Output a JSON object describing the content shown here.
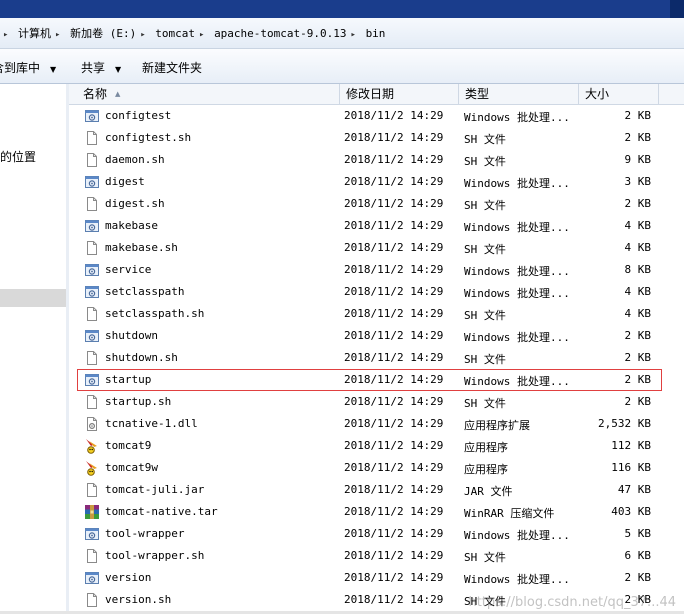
{
  "address_bar": {
    "crumbs": [
      "计算机",
      "新加卷 (E:)",
      "tomcat",
      "apache-tomcat-9.0.13",
      "bin"
    ],
    "lead_arrow": "▸",
    "separator": "▸"
  },
  "toolbar": {
    "library_label": "含到库中",
    "share_label": "共享",
    "new_folder_label": "新建文件夹",
    "dropdown_glyph": "▼"
  },
  "nav_pane": {
    "recent_places_label": "问的位置"
  },
  "columns": {
    "name": "名称",
    "date": "修改日期",
    "type": "类型",
    "size": "大小"
  },
  "files": [
    {
      "name": "configtest",
      "date": "2018/11/2 14:29",
      "type": "Windows 批处理...",
      "size": "2 KB",
      "icon": "batch-file-icon"
    },
    {
      "name": "configtest.sh",
      "date": "2018/11/2 14:29",
      "type": "SH 文件",
      "size": "2 KB",
      "icon": "generic-file-icon"
    },
    {
      "name": "daemon.sh",
      "date": "2018/11/2 14:29",
      "type": "SH 文件",
      "size": "9 KB",
      "icon": "generic-file-icon"
    },
    {
      "name": "digest",
      "date": "2018/11/2 14:29",
      "type": "Windows 批处理...",
      "size": "3 KB",
      "icon": "batch-file-icon"
    },
    {
      "name": "digest.sh",
      "date": "2018/11/2 14:29",
      "type": "SH 文件",
      "size": "2 KB",
      "icon": "generic-file-icon"
    },
    {
      "name": "makebase",
      "date": "2018/11/2 14:29",
      "type": "Windows 批处理...",
      "size": "4 KB",
      "icon": "batch-file-icon"
    },
    {
      "name": "makebase.sh",
      "date": "2018/11/2 14:29",
      "type": "SH 文件",
      "size": "4 KB",
      "icon": "generic-file-icon"
    },
    {
      "name": "service",
      "date": "2018/11/2 14:29",
      "type": "Windows 批处理...",
      "size": "8 KB",
      "icon": "batch-file-icon"
    },
    {
      "name": "setclasspath",
      "date": "2018/11/2 14:29",
      "type": "Windows 批处理...",
      "size": "4 KB",
      "icon": "batch-file-icon"
    },
    {
      "name": "setclasspath.sh",
      "date": "2018/11/2 14:29",
      "type": "SH 文件",
      "size": "4 KB",
      "icon": "generic-file-icon"
    },
    {
      "name": "shutdown",
      "date": "2018/11/2 14:29",
      "type": "Windows 批处理...",
      "size": "2 KB",
      "icon": "batch-file-icon"
    },
    {
      "name": "shutdown.sh",
      "date": "2018/11/2 14:29",
      "type": "SH 文件",
      "size": "2 KB",
      "icon": "generic-file-icon"
    },
    {
      "name": "startup",
      "date": "2018/11/2 14:29",
      "type": "Windows 批处理...",
      "size": "2 KB",
      "icon": "batch-file-icon",
      "highlighted": true
    },
    {
      "name": "startup.sh",
      "date": "2018/11/2 14:29",
      "type": "SH 文件",
      "size": "2 KB",
      "icon": "generic-file-icon"
    },
    {
      "name": "tcnative-1.dll",
      "date": "2018/11/2 14:29",
      "type": "应用程序扩展",
      "size": "2,532 KB",
      "icon": "dll-file-icon"
    },
    {
      "name": "tomcat9",
      "date": "2018/11/2 14:29",
      "type": "应用程序",
      "size": "112 KB",
      "icon": "tomcat-app-icon"
    },
    {
      "name": "tomcat9w",
      "date": "2018/11/2 14:29",
      "type": "应用程序",
      "size": "116 KB",
      "icon": "tomcat-app-icon"
    },
    {
      "name": "tomcat-juli.jar",
      "date": "2018/11/2 14:29",
      "type": "JAR 文件",
      "size": "47 KB",
      "icon": "generic-file-icon"
    },
    {
      "name": "tomcat-native.tar",
      "date": "2018/11/2 14:29",
      "type": "WinRAR 压缩文件",
      "size": "403 KB",
      "icon": "winrar-archive-icon"
    },
    {
      "name": "tool-wrapper",
      "date": "2018/11/2 14:29",
      "type": "Windows 批处理...",
      "size": "5 KB",
      "icon": "batch-file-icon"
    },
    {
      "name": "tool-wrapper.sh",
      "date": "2018/11/2 14:29",
      "type": "SH 文件",
      "size": "6 KB",
      "icon": "generic-file-icon"
    },
    {
      "name": "version",
      "date": "2018/11/2 14:29",
      "type": "Windows 批处理...",
      "size": "2 KB",
      "icon": "batch-file-icon"
    },
    {
      "name": "version.sh",
      "date": "2018/11/2 14:29",
      "type": "SH 文件",
      "size": "2 KB",
      "icon": "generic-file-icon"
    }
  ],
  "watermark": "https://blog.csdn.net/qq_37...44",
  "colors": {
    "title_bar": "#1a3d8c",
    "highlight_outline": "#e04040",
    "selection": "#d9d9d9"
  }
}
